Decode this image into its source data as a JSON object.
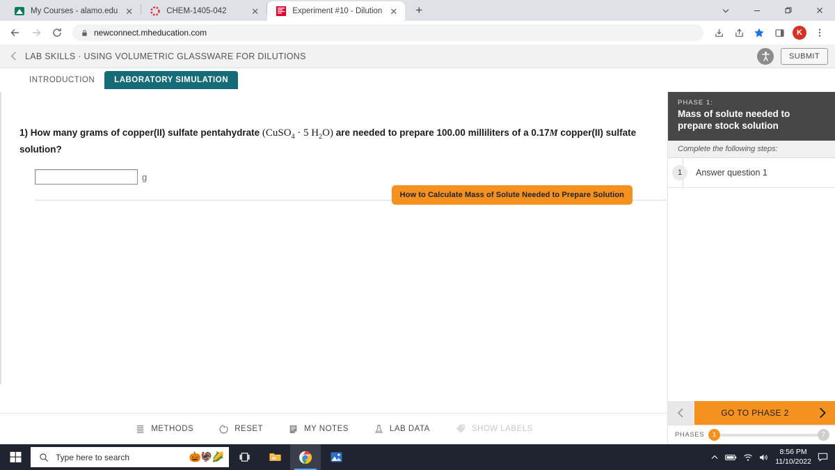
{
  "browser": {
    "tabs": [
      {
        "title": "My Courses - alamo.edu",
        "favicon": "alamo-mountain-icon",
        "active": false
      },
      {
        "title": "CHEM-1405-042",
        "favicon": "canvas-spinner-icon",
        "active": false
      },
      {
        "title": "Experiment #10 - Dilution",
        "favicon": "mcgraw-hill-icon",
        "active": true
      }
    ],
    "new_tab_label": "+",
    "close_label": "✕",
    "url": "newconnect.mheducation.com",
    "toolbar_icons": [
      "back-icon",
      "forward-icon",
      "reload-icon",
      "lock-icon"
    ],
    "right_icons": [
      "install-icon",
      "share-icon",
      "bookmark-star-icon",
      "sidebar-icon"
    ],
    "profile_initial": "K",
    "menu_icon": "kebab-menu-icon",
    "window_controls": [
      "chevron-down-icon",
      "minimize-icon",
      "restore-icon",
      "close-icon"
    ]
  },
  "app_header": {
    "back_icon": "chevron-left-icon",
    "title": "LAB SKILLS · USING VOLUMETRIC GLASSWARE FOR DILUTIONS",
    "accessibility_icon": "accessibility-person-icon",
    "submit_label": "SUBMIT"
  },
  "lesson_tabs": [
    {
      "label": "INTRODUCTION",
      "selected": false
    },
    {
      "label": "LABORATORY SIMULATION",
      "selected": true
    }
  ],
  "hint": {
    "label": "How to Calculate Mass of Solute Needed to Prepare Solution"
  },
  "question": {
    "number": "1)",
    "part1": "How many grams of copper(II) sulfate pentahydrate",
    "formula_open": "(",
    "formula": "CuSO₄ · 5 H₂O",
    "formula_close": ")",
    "part2": "are needed to prepare 100.00 milliliters of a 0.17",
    "molarity_symbol": "M",
    "part3": "copper(II) sulfate solution?",
    "answer_value": "",
    "answer_placeholder": "",
    "unit": "g"
  },
  "tools": [
    {
      "label": "METHODS",
      "icon": "methods-list-icon",
      "enabled": true
    },
    {
      "label": "RESET",
      "icon": "reset-circle-icon",
      "enabled": true
    },
    {
      "label": "MY NOTES",
      "icon": "notes-page-icon",
      "enabled": true
    },
    {
      "label": "LAB DATA",
      "icon": "flask-icon",
      "enabled": true
    },
    {
      "label": "SHOW LABELS",
      "icon": "tag-label-icon",
      "enabled": false
    }
  ],
  "phase_panel": {
    "phase_label": "PHASE 1:",
    "phase_title": "Mass of solute needed to prepare stock solution",
    "steps_intro": "Complete the following steps:",
    "steps": [
      {
        "num": "1",
        "text": "Answer question 1"
      }
    ],
    "nav": {
      "prev_icon": "chevron-left-icon",
      "next_label": "GO TO PHASE 2",
      "next_icon": "chevron-right-icon"
    },
    "phases": {
      "label": "PHASES",
      "current": "1",
      "total": "7"
    }
  },
  "taskbar": {
    "start_icon": "windows-start-icon",
    "search_placeholder": "Type here to search",
    "search_emoji": "🎃🦃🌽",
    "apps": [
      {
        "icon": "task-view-icon",
        "active": false
      },
      {
        "icon": "file-explorer-icon",
        "active": false
      },
      {
        "icon": "chrome-icon",
        "active": true
      },
      {
        "icon": "photos-icon",
        "active": false
      }
    ],
    "tray_icons": [
      "chevron-up-icon",
      "battery-icon",
      "wifi-icon",
      "volume-icon"
    ],
    "time": "8:56 PM",
    "date": "11/10/2022",
    "action_center_icon": "notification-icon"
  },
  "colors": {
    "teal": "#156c77",
    "orange": "#f5911e",
    "phase_header": "#464646",
    "chrome_bg": "#dee1e6"
  }
}
